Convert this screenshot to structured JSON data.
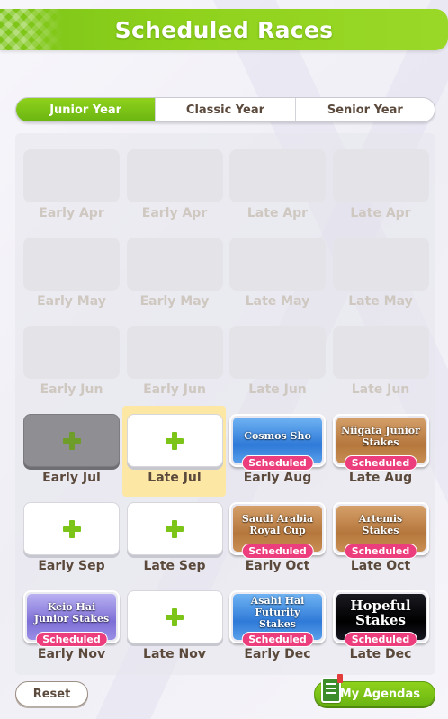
{
  "header": {
    "title": "Scheduled Races"
  },
  "tabs": [
    {
      "label": "Junior Year",
      "active": true
    },
    {
      "label": "Classic Year",
      "active": false
    },
    {
      "label": "Senior Year",
      "active": false
    }
  ],
  "slots": [
    {
      "label": "Early Apr",
      "state": "disabled"
    },
    {
      "label": "Early Apr",
      "state": "disabled"
    },
    {
      "label": "Late Apr",
      "state": "disabled"
    },
    {
      "label": "Late Apr",
      "state": "disabled"
    },
    {
      "label": "Early May",
      "state": "disabled"
    },
    {
      "label": "Early May",
      "state": "disabled"
    },
    {
      "label": "Late May",
      "state": "disabled"
    },
    {
      "label": "Late May",
      "state": "disabled"
    },
    {
      "label": "Early Jun",
      "state": "disabled"
    },
    {
      "label": "Early Jun",
      "state": "disabled"
    },
    {
      "label": "Late Jun",
      "state": "disabled"
    },
    {
      "label": "Late Jun",
      "state": "disabled"
    },
    {
      "label": "Early Jul",
      "state": "add-pressed"
    },
    {
      "label": "Late Jul",
      "state": "add-highlighted"
    },
    {
      "label": "Early Aug",
      "state": "race",
      "race": "Cosmos Sho",
      "badge": "Scheduled",
      "grade_color": "#2f7ad8"
    },
    {
      "label": "Late Aug",
      "state": "race",
      "race": "Niigata Junior Stakes",
      "badge": "Scheduled",
      "grade_color": "#b5773c"
    },
    {
      "label": "Early Sep",
      "state": "add"
    },
    {
      "label": "Late Sep",
      "state": "add"
    },
    {
      "label": "Early Oct",
      "state": "race",
      "race": "Saudi Arabia Royal Cup",
      "badge": "Scheduled",
      "grade_color": "#b5773c"
    },
    {
      "label": "Late Oct",
      "state": "race",
      "race": "Artemis Stakes",
      "badge": "Scheduled",
      "grade_color": "#b5773c"
    },
    {
      "label": "Early Nov",
      "state": "race",
      "race": "Keio Hai Junior Stakes",
      "badge": "Scheduled",
      "grade_color": "#7d6fd6"
    },
    {
      "label": "Late Nov",
      "state": "add"
    },
    {
      "label": "Early Dec",
      "state": "race",
      "race": "Asahi Hai Futurity Stakes",
      "badge": "Scheduled",
      "grade_color": "#2f7ad8"
    },
    {
      "label": "Late Dec",
      "state": "race",
      "race": "Hopeful Stakes",
      "badge": "Scheduled",
      "grade_color": "#000000"
    }
  ],
  "footer": {
    "reset_label": "Reset",
    "agendas_label": "My Agendas"
  },
  "colors": {
    "accent_green": "#8fd21c",
    "scheduled_pink": "#ec3e7c",
    "text_brown": "#5b4a3c"
  }
}
